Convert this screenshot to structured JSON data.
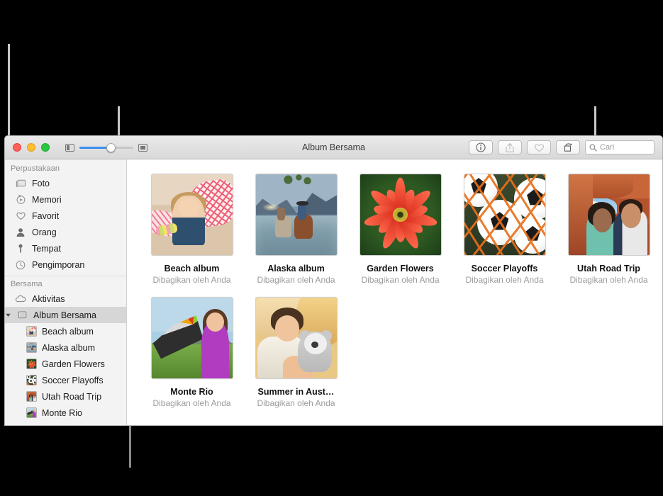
{
  "window": {
    "title": "Album Bersama",
    "traffic_lights": [
      "close-button",
      "minimize-button",
      "zoom-button"
    ],
    "zoom_slider": {
      "min_icon": "small-thumbnail-icon",
      "max_icon": "large-thumbnail-icon",
      "value_percent": 50
    }
  },
  "toolbar": {
    "buttons": [
      {
        "name": "info-button",
        "icon": "info-icon",
        "enabled": true
      },
      {
        "name": "share-button",
        "icon": "share-icon",
        "enabled": false
      },
      {
        "name": "favorite-button",
        "icon": "heart-icon",
        "enabled": false
      },
      {
        "name": "rotate-button",
        "icon": "rotate-icon",
        "enabled": true
      }
    ],
    "search": {
      "placeholder": "Cari",
      "value": "",
      "icon": "search-icon"
    }
  },
  "sidebar": {
    "sections": [
      {
        "header": "Perpustakaan",
        "items": [
          {
            "label": "Foto",
            "icon": "photos-icon"
          },
          {
            "label": "Memori",
            "icon": "memories-icon"
          },
          {
            "label": "Favorit",
            "icon": "heart-icon"
          },
          {
            "label": "Orang",
            "icon": "person-icon"
          },
          {
            "label": "Tempat",
            "icon": "pin-icon"
          },
          {
            "label": "Pengimporan",
            "icon": "clock-icon"
          }
        ]
      },
      {
        "header": "Bersama",
        "items": [
          {
            "label": "Aktivitas",
            "icon": "cloud-icon"
          }
        ]
      }
    ],
    "shared_albums_row": {
      "label": "Album Bersama",
      "icon": "shared-album-icon",
      "expanded": true,
      "selected": true
    },
    "albums": [
      {
        "label": "Beach album",
        "art": "beach"
      },
      {
        "label": "Alaska album",
        "art": "alaska"
      },
      {
        "label": "Garden Flowers",
        "art": "garden"
      },
      {
        "label": "Soccer Playoffs",
        "art": "soccer"
      },
      {
        "label": "Utah Road Trip",
        "art": "utah"
      },
      {
        "label": "Monte Rio",
        "art": "monte"
      }
    ]
  },
  "main": {
    "shared_by_label": "Dibagikan oleh Anda",
    "albums": [
      {
        "title": "Beach album",
        "subtitle": "Dibagikan oleh Anda",
        "art": "beach"
      },
      {
        "title": "Alaska album",
        "subtitle": "Dibagikan oleh Anda",
        "art": "alaska"
      },
      {
        "title": "Garden Flowers",
        "subtitle": "Dibagikan oleh Anda",
        "art": "garden"
      },
      {
        "title": "Soccer Playoffs",
        "subtitle": "Dibagikan oleh Anda",
        "art": "soccer"
      },
      {
        "title": "Utah Road Trip",
        "subtitle": "Dibagikan oleh Anda",
        "art": "utah"
      },
      {
        "title": "Monte Rio",
        "subtitle": "Dibagikan oleh Anda",
        "art": "monte"
      },
      {
        "title": "Summer in Aust…",
        "subtitle": "Dibagikan oleh Anda",
        "art": "summer"
      }
    ]
  },
  "colors": {
    "accent": "#3b8ef0",
    "sidebar_bg": "#f3f3f3",
    "selected_row": "#d6d6d6",
    "caption": "#111111",
    "subtitle": "#9b9b9b",
    "callout_line": "#c8c8c8",
    "bracket_line": "#8a8a8a"
  }
}
